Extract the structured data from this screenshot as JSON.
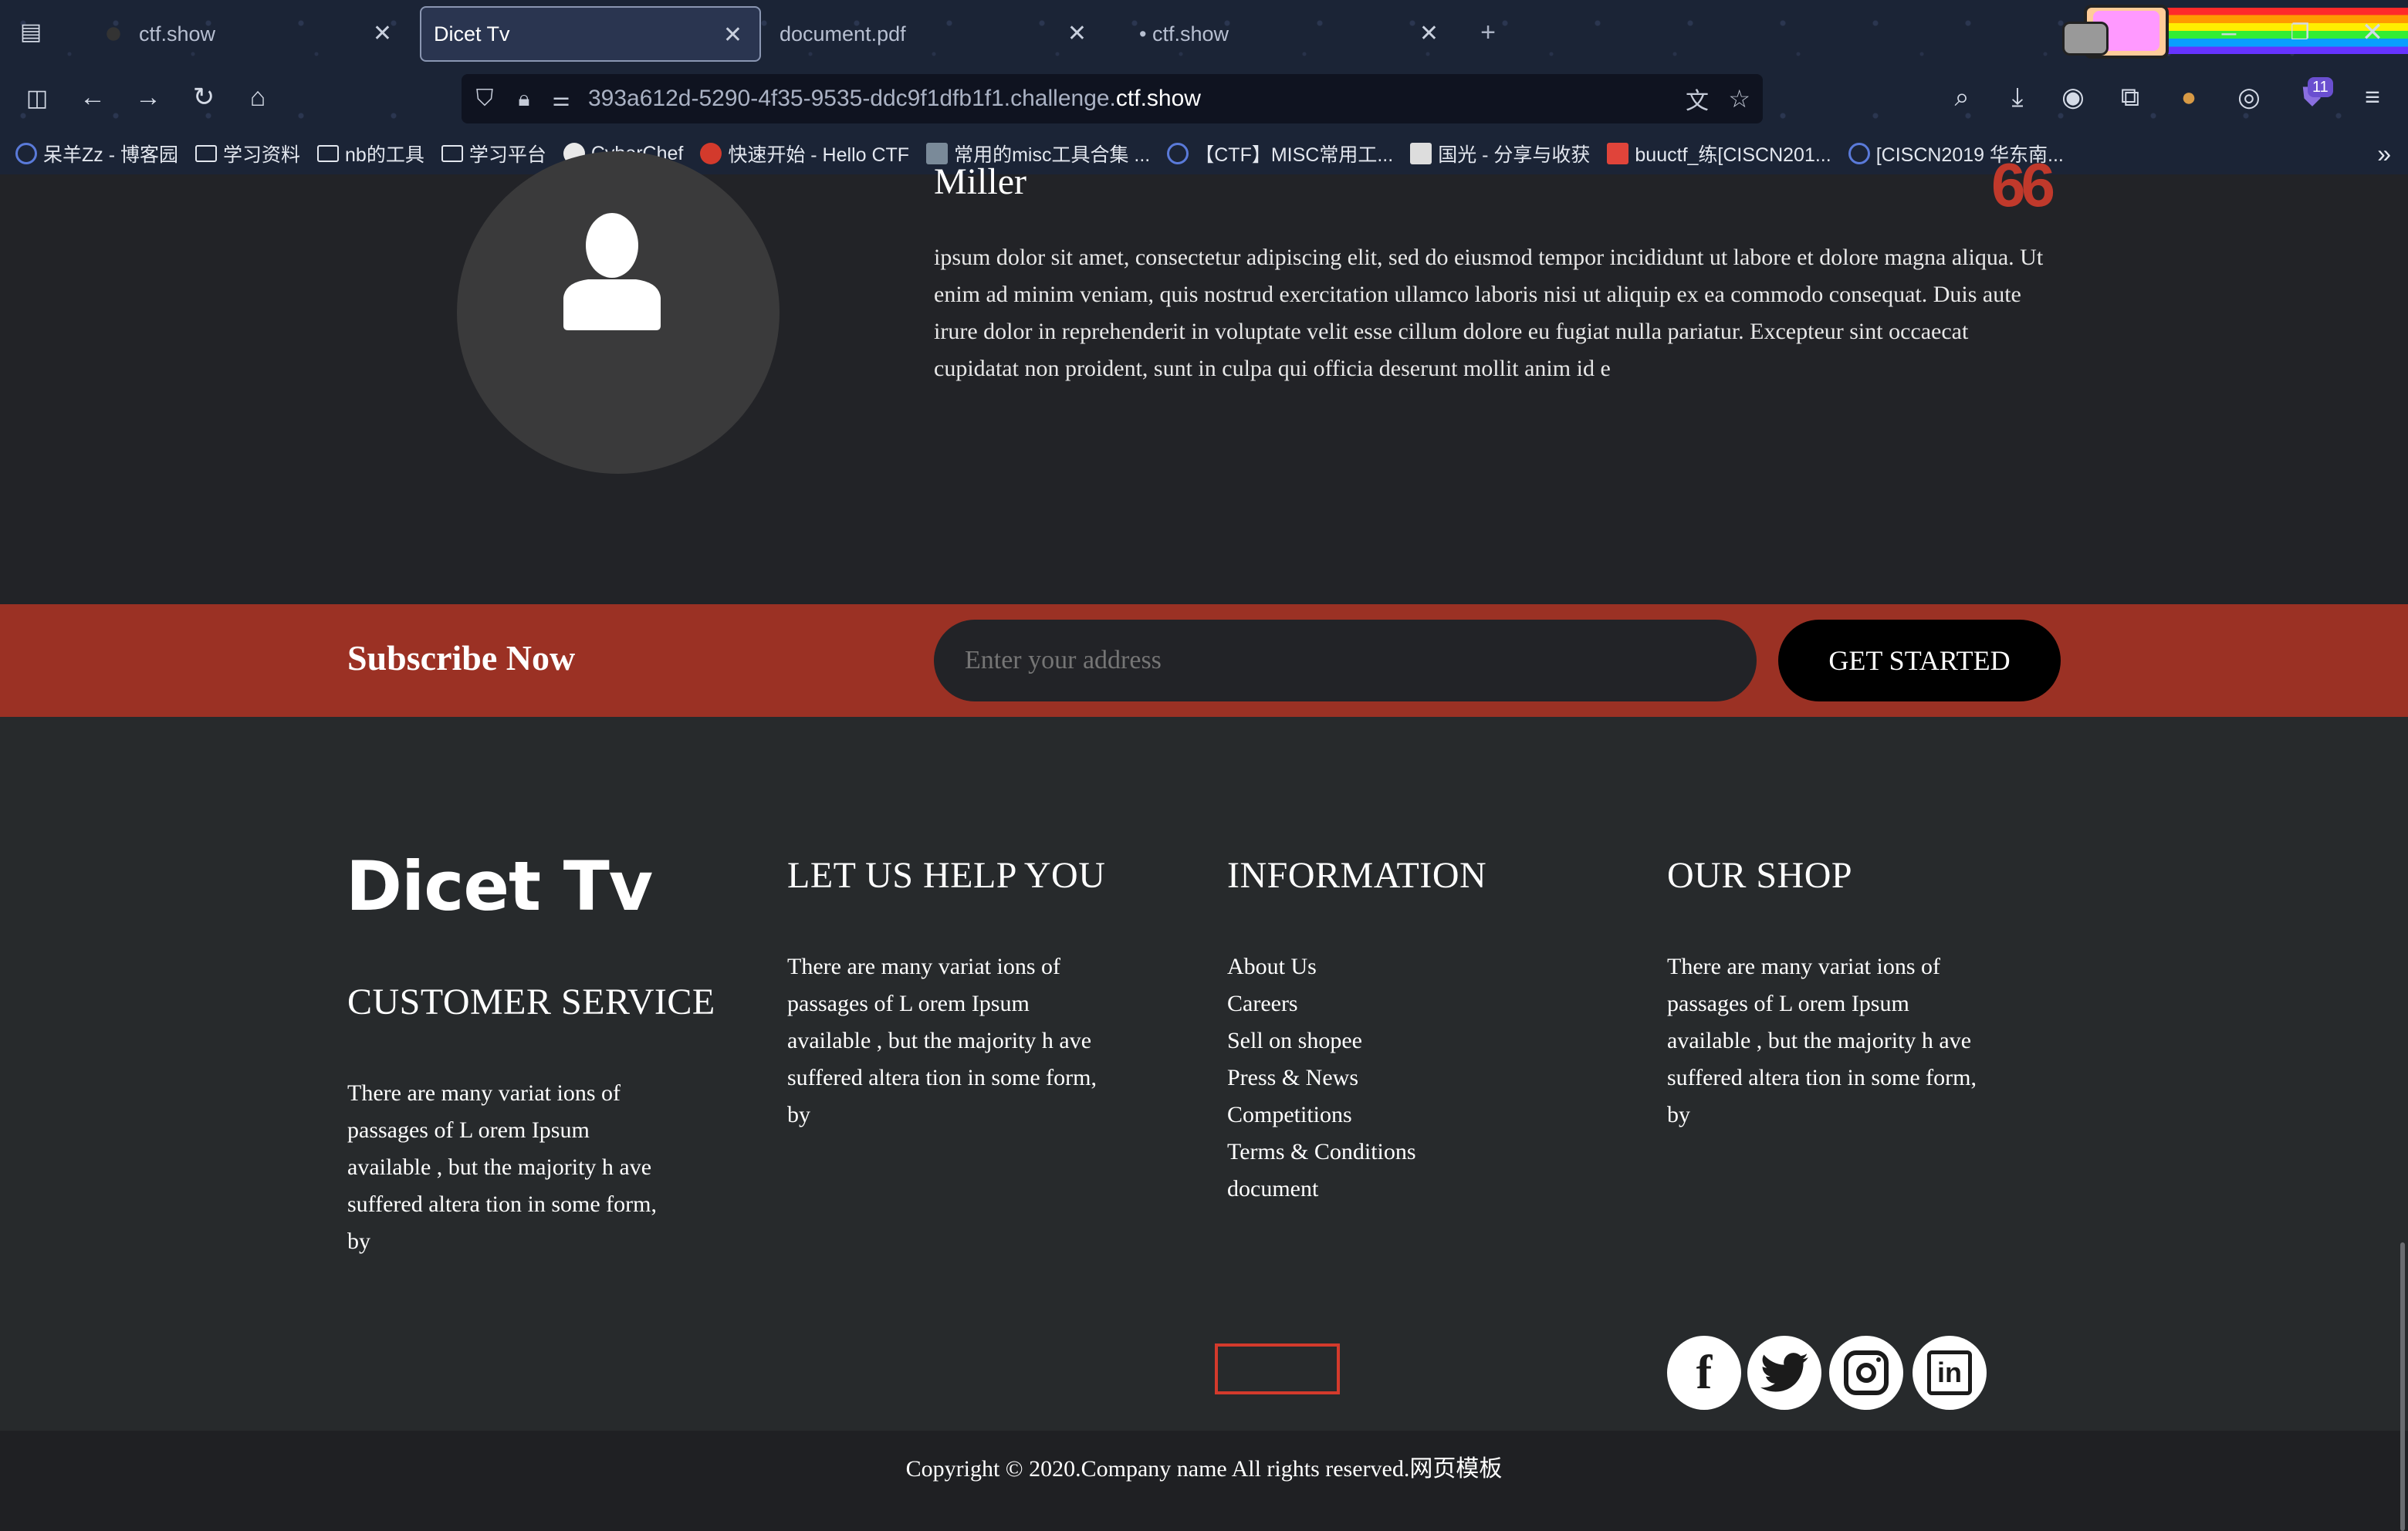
{
  "browser": {
    "tabs": [
      {
        "label": "ctf.show",
        "active": false
      },
      {
        "label": "Dicet Tv",
        "active": true
      },
      {
        "label": "document.pdf",
        "active": false
      },
      {
        "label": "• ctf.show",
        "active": false
      }
    ],
    "new_tab": "+",
    "url_prefix": "393a612d-5290-4f35-9535-ddc9f1dfb1f1.challenge.",
    "url_domain": "ctf.show",
    "extensions_badge": "11",
    "bookmarks": [
      "呆羊Zz - 博客园",
      "学习资料",
      "nb的工具",
      "学习平台",
      "CyberChef",
      "快速开始 - Hello CTF",
      "常用的misc工具合集 ...",
      "【CTF】MISC常用工...",
      "国光 - 分享与收获",
      "buuctf_练[CISCN201...",
      "[CISCN2019 华东南..."
    ]
  },
  "team": {
    "name": "Miller",
    "bio": "ipsum dolor sit amet, consectetur adipiscing elit, sed do eiusmod tempor incididunt ut labore et dolore magna aliqua. Ut enim ad minim veniam, quis nostrud exercitation ullamco laboris nisi ut aliquip ex ea commodo consequat. Duis aute irure dolor in reprehenderit in voluptate velit esse cillum dolore eu fugiat nulla pariatur. Excepteur sint occaecat cupidatat non proident, sunt in culpa qui officia deserunt mollit anim id e",
    "quote_mark": "66"
  },
  "subscribe": {
    "title": "Subscribe Now",
    "placeholder": "Enter your address",
    "button": "GET STARTED"
  },
  "footer": {
    "logo": "Dicet Tv",
    "customer_service": {
      "title": "CUSTOMER SERVICE",
      "text": "There are many variat ions of passages of L orem Ipsum available , but the majority h ave suffered altera tion in some form, by"
    },
    "help": {
      "title": "LET US HELP YOU",
      "text": "There are many variat ions of passages of L orem Ipsum available , but the majority h ave suffered altera tion in some form, by"
    },
    "information": {
      "title": "INFORMATION",
      "links": [
        "About Us",
        "Careers",
        "Sell on shopee",
        "Press & News",
        "Competitions",
        "Terms & Conditions",
        "document"
      ]
    },
    "shop": {
      "title": "OUR SHOP",
      "text": "There are many variat ions of passages of L orem Ipsum available , but the majority h ave suffered altera tion in some form, by"
    },
    "social_icons": [
      "facebook-icon",
      "twitter-icon",
      "instagram-icon",
      "linkedin-icon"
    ],
    "highlight_color": "#d33a2c"
  },
  "copyright": "Copyright © 2020.Company name All rights reserved.网页模板",
  "colors": {
    "subscribe_bg": "#9b3124",
    "footer_bg": "#272a2c",
    "accent": "#c0392b"
  }
}
